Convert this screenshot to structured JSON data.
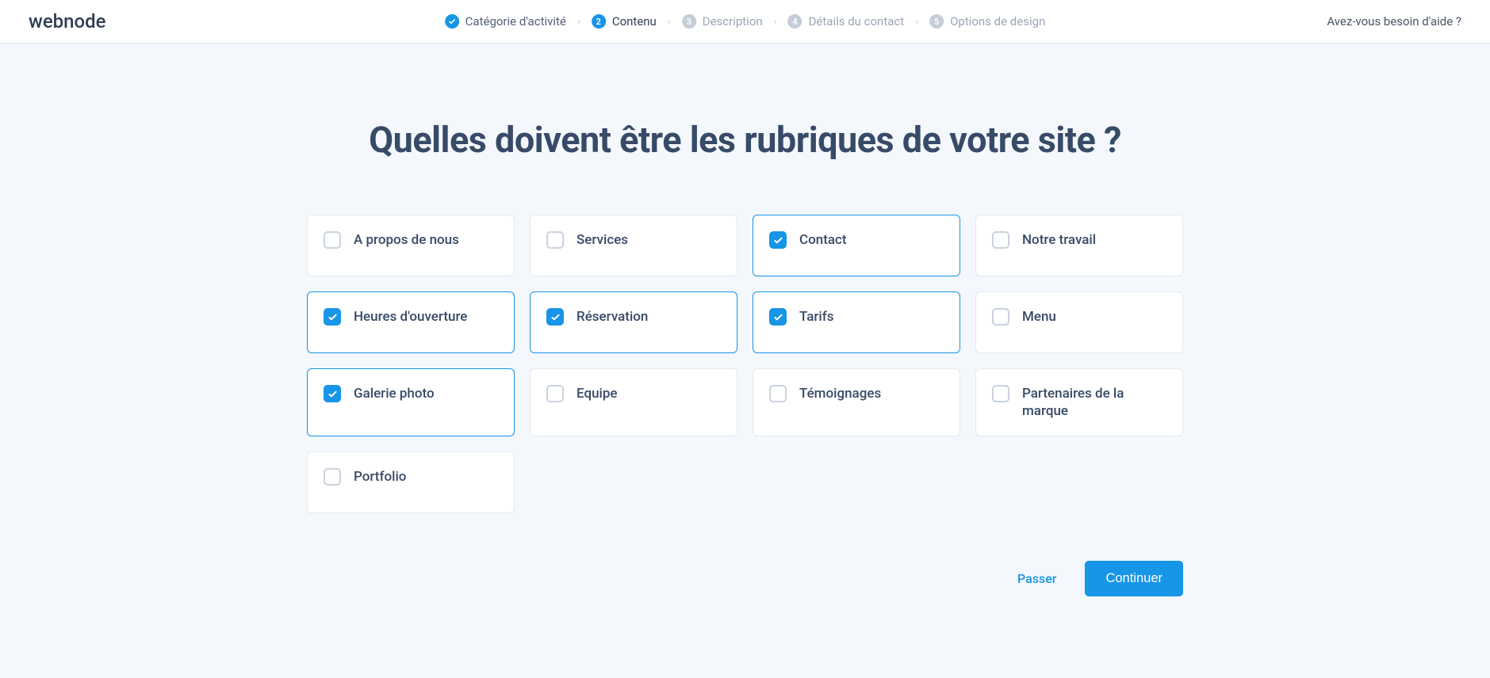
{
  "brand": "webnode",
  "help_link": "Avez-vous besoin d'aide ?",
  "stepper": [
    {
      "label": "Catégorie d'activité",
      "state": "done"
    },
    {
      "label": "Contenu",
      "state": "current",
      "num": "2"
    },
    {
      "label": "Description",
      "state": "upcoming",
      "num": "3"
    },
    {
      "label": "Détails du contact",
      "state": "upcoming",
      "num": "4"
    },
    {
      "label": "Options de design",
      "state": "upcoming",
      "num": "5"
    }
  ],
  "title": "Quelles doivent être les rubriques de votre site ?",
  "options": [
    {
      "label": "A propos de nous",
      "checked": false
    },
    {
      "label": "Services",
      "checked": false
    },
    {
      "label": "Contact",
      "checked": true
    },
    {
      "label": "Notre travail",
      "checked": false
    },
    {
      "label": "Heures d'ouverture",
      "checked": true
    },
    {
      "label": "Réservation",
      "checked": true
    },
    {
      "label": "Tarifs",
      "checked": true
    },
    {
      "label": "Menu",
      "checked": false
    },
    {
      "label": "Galerie photo",
      "checked": true
    },
    {
      "label": "Equipe",
      "checked": false
    },
    {
      "label": "Témoignages",
      "checked": false
    },
    {
      "label": "Partenaires de la marque",
      "checked": false
    },
    {
      "label": "Portfolio",
      "checked": false
    }
  ],
  "actions": {
    "skip": "Passer",
    "continue": "Continuer"
  },
  "colors": {
    "accent": "#1795e6",
    "page_bg": "#f4f7fb",
    "text_primary": "#374a67",
    "text_muted": "#9aa6b8"
  }
}
